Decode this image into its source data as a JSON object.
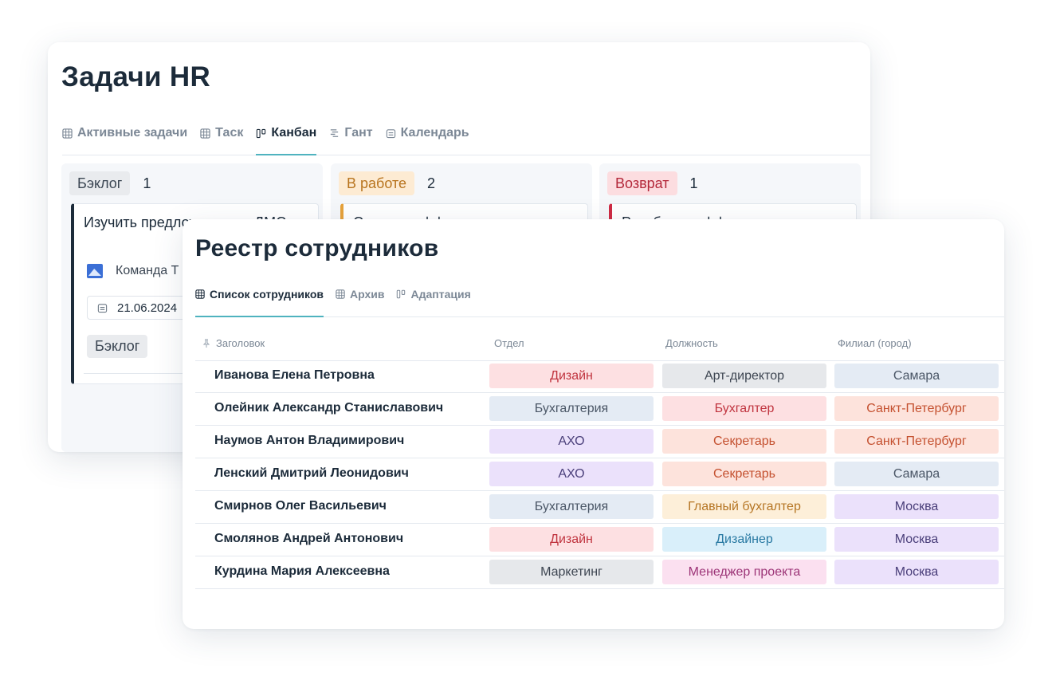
{
  "colors": {
    "accent": "#4fb3bf",
    "text": "#1c2b3a",
    "muted": "#7c8896"
  },
  "hr_tasks": {
    "title": "Задачи HR",
    "tabs": [
      {
        "label": "Активные задачи",
        "icon": "table-icon",
        "active": false
      },
      {
        "label": "Таск",
        "icon": "table-icon",
        "active": false
      },
      {
        "label": "Канбан",
        "icon": "kanban-icon",
        "active": true
      },
      {
        "label": "Гант",
        "icon": "gantt-icon",
        "active": false
      },
      {
        "label": "Календарь",
        "icon": "calendar-icon",
        "active": false
      }
    ],
    "columns": [
      {
        "status": "Бэклог",
        "count": "1",
        "pill_bg": "#e9ebee",
        "pill_fg": "#3b4653",
        "bar": "#1c2b3a",
        "card": {
          "title": "Изучить предложения по ДМС",
          "team": "Команда Т",
          "date": "21.06.2024",
          "status": "Бэклог"
        }
      },
      {
        "status": "В работе",
        "count": "2",
        "pill_bg": "#fdebd3",
        "pill_fg": "#b8741e",
        "bar": "#e7a23a",
        "card": {
          "title": "Сделать оффер",
          "team": "",
          "date": "",
          "status": ""
        }
      },
      {
        "status": "Возврат",
        "count": "1",
        "pill_bg": "#fcdde0",
        "pill_fg": "#b3283a",
        "bar": "#cf2a43",
        "card": {
          "title": "Разобрать оффер",
          "team": "",
          "date": "",
          "status": ""
        }
      }
    ]
  },
  "registry": {
    "title": "Реестр сотрудников",
    "tabs": [
      {
        "label": "Список сотрудников",
        "icon": "table-icon",
        "active": true
      },
      {
        "label": "Архив",
        "icon": "table-icon",
        "active": false
      },
      {
        "label": "Адаптация",
        "icon": "kanban-icon",
        "active": false
      }
    ],
    "columns": {
      "title": "Заголовок",
      "dept": "Отдел",
      "position": "Должность",
      "city": "Филиал (город)"
    },
    "rows": [
      {
        "name": "Иванова Елена Петровна",
        "dept": "Дизайн",
        "position": "Арт-директор",
        "city": "Самара"
      },
      {
        "name": "Олейник Александр Станиславович",
        "dept": "Бухгалтерия",
        "position": "Бухгалтер",
        "city": "Санкт-Петербург"
      },
      {
        "name": "Наумов Антон Владимирович",
        "dept": "АХО",
        "position": "Секретарь",
        "city": "Санкт-Петербург"
      },
      {
        "name": "Ленский Дмитрий Леонидович",
        "dept": "АХО",
        "position": "Секретарь",
        "city": "Самара"
      },
      {
        "name": "Смирнов Олег Васильевич",
        "dept": "Бухгалтерия",
        "position": "Главный бухгалтер",
        "city": "Москва"
      },
      {
        "name": "Смолянов Андрей Антонович",
        "dept": "Дизайн",
        "position": "Дизайнер",
        "city": "Москва"
      },
      {
        "name": "Курдина Мария Алексеевна",
        "dept": "Маркетинг",
        "position": "Менеджер проекта",
        "city": "Москва"
      }
    ],
    "tag_styles": {
      "Дизайн": {
        "bg": "#fde0e2",
        "fg": "#c0343f"
      },
      "Бухгалтерия": {
        "bg": "#e4ebf4",
        "fg": "#4a5666"
      },
      "АХО": {
        "bg": "#ebe1fb",
        "fg": "#4a3f7a"
      },
      "Маркетинг": {
        "bg": "#e6e8eb",
        "fg": "#3e4652"
      },
      "Арт-директор": {
        "bg": "#e6e8eb",
        "fg": "#3e4652"
      },
      "Бухгалтер": {
        "bg": "#fde0e2",
        "fg": "#c0343f"
      },
      "Секретарь": {
        "bg": "#fde3dc",
        "fg": "#c4502f"
      },
      "Главный бухгалтер": {
        "bg": "#fdefd9",
        "fg": "#b57523"
      },
      "Дизайнер": {
        "bg": "#d9effa",
        "fg": "#2a7aa3"
      },
      "Менеджер проекта": {
        "bg": "#fbe0f0",
        "fg": "#9c3477"
      },
      "Самара": {
        "bg": "#e4ebf4",
        "fg": "#4a5666"
      },
      "Санкт-Петербург": {
        "bg": "#fde3dc",
        "fg": "#c4502f"
      },
      "Москва": {
        "bg": "#ebe1fb",
        "fg": "#4a3f7a"
      }
    }
  }
}
